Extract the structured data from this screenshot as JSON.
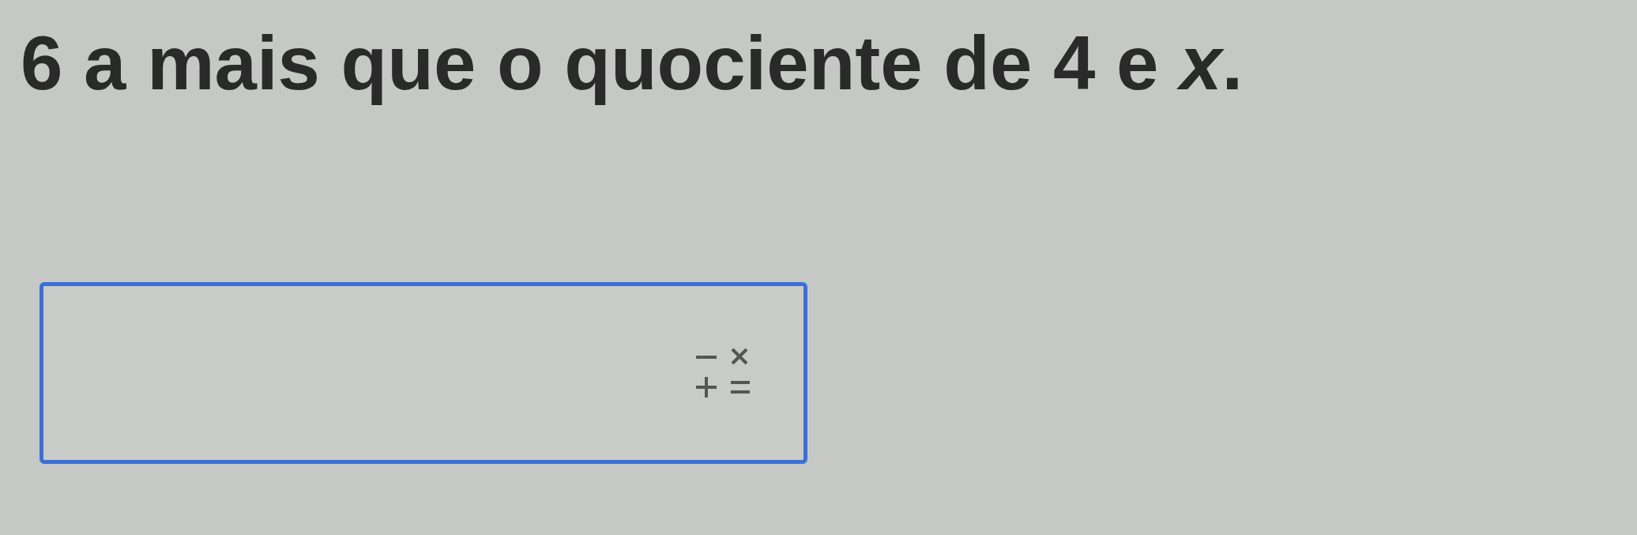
{
  "question": {
    "text": "6 a mais que o quociente de 4 e *x*."
  }
}
